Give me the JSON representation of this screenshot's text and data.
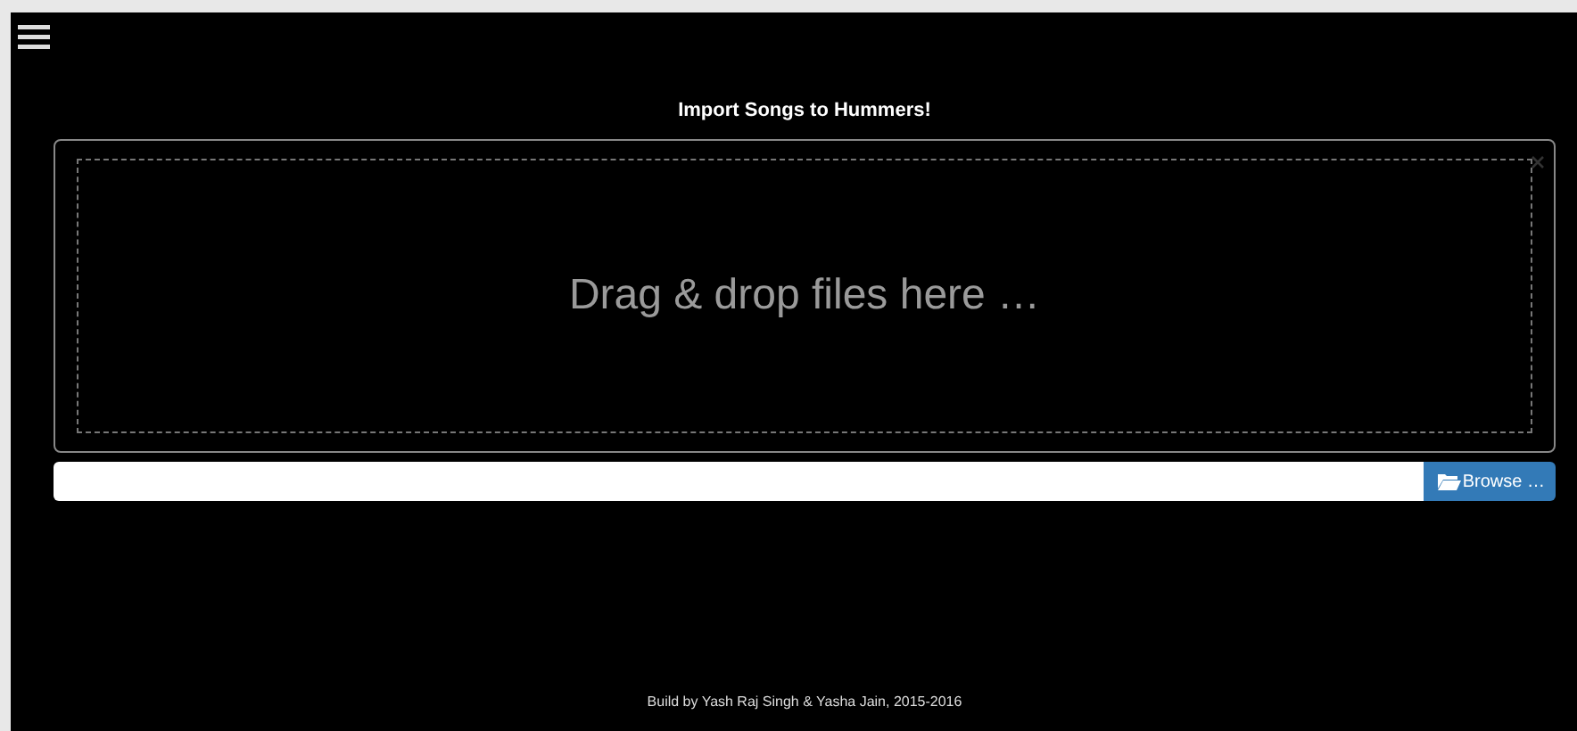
{
  "title": "Import Songs to Hummers!",
  "dropzone": {
    "prompt": "Drag & drop files here …"
  },
  "file_field": {
    "button": "Browse …"
  },
  "footer": "Build by Yash Raj Singh & Yasha Jain, 2015-2016"
}
